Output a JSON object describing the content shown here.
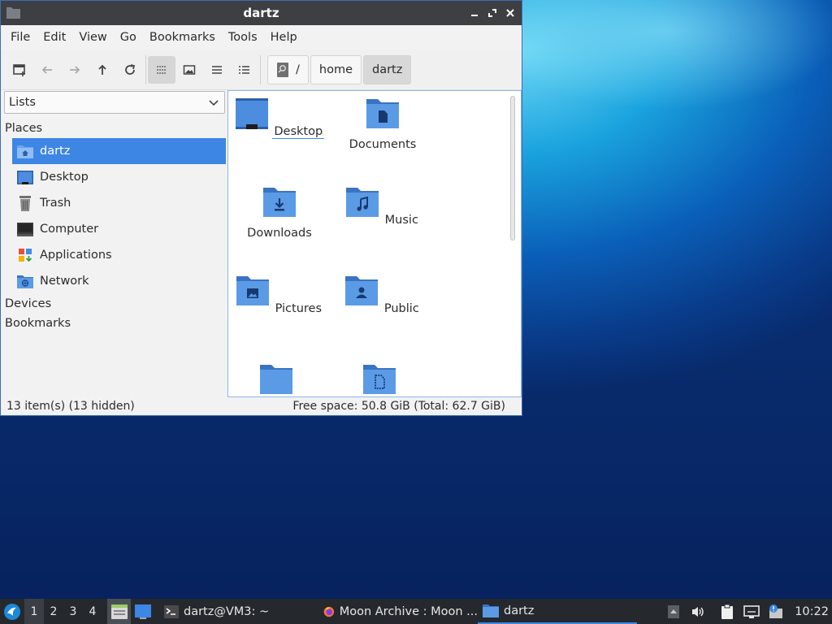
{
  "window": {
    "title": "dartz"
  },
  "menubar": {
    "items": [
      "File",
      "Edit",
      "View",
      "Go",
      "Bookmarks",
      "Tools",
      "Help"
    ]
  },
  "toolbar": {
    "buttons": [
      "new-tab-icon",
      "back-arrow-icon",
      "forward-arrow-icon",
      "up-arrow-icon",
      "reload-icon",
      "icon-view-icon",
      "thumbnail-view-icon",
      "compact-view-icon",
      "detailed-list-view-icon"
    ],
    "active_view": "icon-view-icon"
  },
  "pathbar": {
    "root": "/",
    "segments": [
      "home",
      "dartz"
    ]
  },
  "side_pane": {
    "mode": "Lists",
    "sections": {
      "places": "Places",
      "devices": "Devices",
      "bookmarks": "Bookmarks"
    },
    "places": [
      {
        "label": "dartz",
        "icon": "home-folder-icon",
        "selected": true
      },
      {
        "label": "Desktop",
        "icon": "desktop-icon",
        "selected": false
      },
      {
        "label": "Trash",
        "icon": "trash-icon",
        "selected": false
      },
      {
        "label": "Computer",
        "icon": "computer-icon",
        "selected": false
      },
      {
        "label": "Applications",
        "icon": "applications-icon",
        "selected": false
      },
      {
        "label": "Network",
        "icon": "network-icon",
        "selected": false
      }
    ]
  },
  "files": [
    {
      "label": "Desktop",
      "icon": "desktop-folder-icon",
      "focused": true
    },
    {
      "label": "Documents",
      "icon": "documents-folder-icon",
      "focused": false
    },
    {
      "label": "Downloads",
      "icon": "downloads-folder-icon",
      "focused": false
    },
    {
      "label": "Music",
      "icon": "music-folder-icon",
      "focused": false
    },
    {
      "label": "Pictures",
      "icon": "pictures-folder-icon",
      "focused": false
    },
    {
      "label": "Public",
      "icon": "public-folder-icon",
      "focused": false
    },
    {
      "label": "",
      "icon": "folder-icon",
      "focused": false
    },
    {
      "label": "",
      "icon": "templates-folder-icon",
      "focused": false
    }
  ],
  "statusbar": {
    "items": "13 item(s) (13 hidden)",
    "free_space": "Free space: 50.8 GiB (Total: 62.7 GiB)"
  },
  "taskbar": {
    "desktops": [
      "1",
      "2",
      "3",
      "4"
    ],
    "active_desktop": "1",
    "tasks": [
      {
        "label": "dartz@VM3: ~",
        "icon": "terminal-icon"
      },
      {
        "label": "Moon Archive : Moon ...",
        "icon": "firefox-icon"
      },
      {
        "label": "dartz",
        "icon": "folder-icon"
      }
    ],
    "clock": "10:22"
  },
  "colors": {
    "accent": "#3d86e3",
    "titlebar": "#3d3f42",
    "taskbar": "#25292e",
    "folder": "#5b9be6"
  }
}
